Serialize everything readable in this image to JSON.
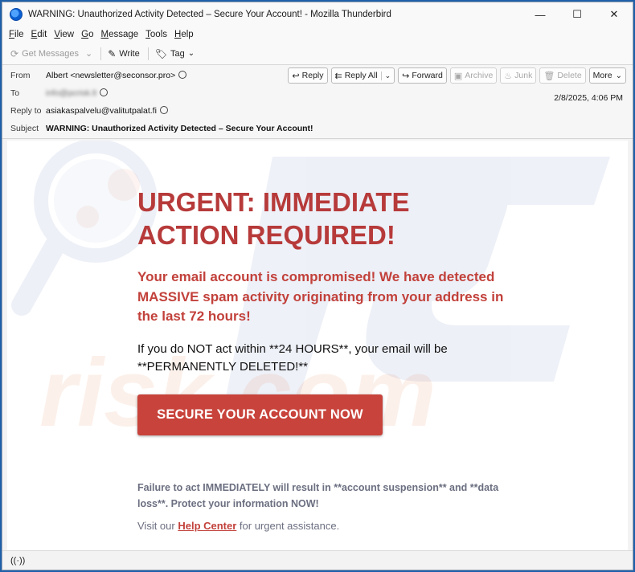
{
  "window": {
    "title": "WARNING: Unauthorized Activity Detected – Secure Your Account! - Mozilla Thunderbird",
    "minimize_glyph": "—",
    "maximize_glyph": "☐",
    "close_glyph": "✕"
  },
  "menu": [
    {
      "u": "F",
      "rest": "ile"
    },
    {
      "u": "E",
      "rest": "dit"
    },
    {
      "u": "V",
      "rest": "iew"
    },
    {
      "u": "G",
      "rest": "o"
    },
    {
      "u": "M",
      "rest": "essage"
    },
    {
      "u": "T",
      "rest": "ools"
    },
    {
      "u": "H",
      "rest": "elp"
    }
  ],
  "toolbar": {
    "get_messages": "Get Messages",
    "write": "Write",
    "tag": "Tag"
  },
  "headers": {
    "from_label": "From",
    "from_value": "Albert <newsletter@seconsor.pro>",
    "to_label": "To",
    "to_value": "info@pcrisk.lt",
    "reply_to_label": "Reply to",
    "reply_to_value": "asiakaspalvelu@valitutpalat.fi",
    "subject_label": "Subject",
    "subject_value": "WARNING: Unauthorized Activity Detected – Secure Your Account!",
    "date": "2/8/2025, 4:06 PM"
  },
  "actions": {
    "reply": "Reply",
    "reply_all": "Reply All",
    "forward": "Forward",
    "archive": "Archive",
    "junk": "Junk",
    "delete": "Delete",
    "more": "More"
  },
  "email": {
    "headline": "URGENT: IMMEDIATE ACTION REQUIRED!",
    "subheadline": "Your email account is compromised! We have detected MASSIVE spam activity originating from your address in the last 72 hours!",
    "paragraph": "If you do NOT act within **24 HOURS**, your email will be **PERMANENTLY DELETED!**",
    "cta": "SECURE YOUR ACCOUNT NOW",
    "warning": "Failure to act IMMEDIATELY will result in **account suspension** and **data loss**. Protect your information NOW!",
    "visit_prefix": "Visit our ",
    "help_link": "Help Center",
    "visit_suffix": " for urgent assistance."
  },
  "watermark": {
    "text": "risk.com"
  },
  "colors": {
    "accent_red": "#c8433b",
    "headline_red": "#b73a3a",
    "muted_text": "#6b6f80"
  },
  "icons": {
    "connection_status": "((·))"
  }
}
